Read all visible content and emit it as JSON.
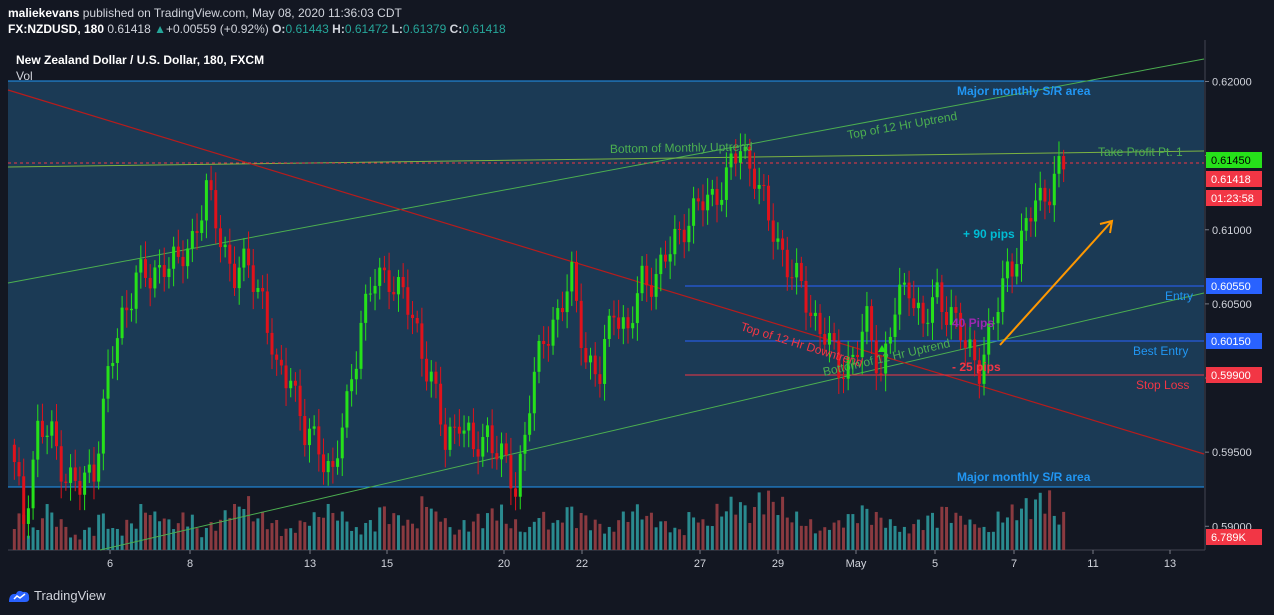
{
  "header": {
    "author": "maliekevans",
    "published_text": "published on TradingView.com, May 08, 2020 11:36:03 CDT",
    "symbol": "FX:NZDUSD, 180",
    "last": "0.61418",
    "change": "+0.00559 (+0.92%)",
    "o_label": "O:",
    "o": "0.61443",
    "h_label": "H:",
    "h": "0.61472",
    "l_label": "L:",
    "l": "0.61379",
    "c_label": "C:",
    "c": "0.61418"
  },
  "legend": {
    "title": "New Zealand Dollar / U.S. Dollar, 180, FXCM",
    "vol": "Vol"
  },
  "footer": {
    "brand": "TradingView"
  },
  "colors": {
    "plot_bg": "#1b3a55",
    "up": "#26e11a",
    "down": "#e0121b",
    "vol_up": "#2a8a8f",
    "vol_down": "#8a3a40",
    "accent_blue": "#2962ff"
  },
  "chart_data": {
    "type": "candlestick",
    "title": "New Zealand Dollar / U.S. Dollar, 180, FXCM",
    "ylim": [
      0.5884,
      0.6228
    ],
    "y_ticks": [
      "0.62000",
      "0.61500",
      "0.61000",
      "0.60500",
      "0.60000",
      "0.59500",
      "0.59000"
    ],
    "x_ticks": [
      "6",
      "8",
      "13",
      "15",
      "20",
      "22",
      "27",
      "29",
      "May",
      "5",
      "7",
      "11",
      "13"
    ],
    "price_labels": [
      {
        "text": "0.61450",
        "value": 0.6145,
        "color": "#26e11a",
        "text_color": "#000000"
      },
      {
        "text": "0.61418",
        "value": 0.61418,
        "color": "#f23645",
        "text_color": "#ffffff"
      },
      {
        "text": "01:23:58",
        "value": 0.6129,
        "color": "#f23645",
        "text_color": "#ffffff"
      },
      {
        "text": "0.60550",
        "value": 0.6055,
        "color": "#2962ff",
        "text_color": "#ffffff"
      },
      {
        "text": "0.60150",
        "value": 0.6015,
        "color": "#2962ff",
        "text_color": "#ffffff"
      },
      {
        "text": "0.59900",
        "value": 0.599,
        "color": "#f23645",
        "text_color": "#ffffff"
      },
      {
        "text": "6.789K",
        "value": 0.5902,
        "color": "#f23645",
        "text_color": "#ffffff"
      }
    ],
    "annotations": [
      {
        "text": "Major monthly S/R area",
        "color": "#2196f3"
      },
      {
        "text": "Major monthly S/R area",
        "color": "#2196f3"
      },
      {
        "text": "Top of 12 Hr Uptrend",
        "color": "#4caf50"
      },
      {
        "text": "Bottom of Monthly Uptrend",
        "color": "#4caf50"
      },
      {
        "text": "Take Profit Pt. 1",
        "color": "#4caf50"
      },
      {
        "text": "+ 90 pips",
        "color": "#00bcd4"
      },
      {
        "text": "Entry",
        "color": "#2196f3"
      },
      {
        "text": "40 Pips",
        "color": "#9c27b0"
      },
      {
        "text": "Best Entry",
        "color": "#2196f3"
      },
      {
        "text": "- 25 pips",
        "color": "#f23645"
      },
      {
        "text": "Stop Loss",
        "color": "#f23645"
      },
      {
        "text": "Top of 12 Hr Downtrend",
        "color": "#f23645"
      },
      {
        "text": "Bottom of 12 Hr Uptrend",
        "color": "#4caf50"
      }
    ],
    "levels": {
      "sr_top": 0.62,
      "sr_bottom": 0.5908,
      "take_profit": 0.6145,
      "entry": 0.6055,
      "best_entry": 0.6015,
      "stop_loss": 0.599,
      "current_price": 0.61418
    },
    "path": [
      0.5955,
      0.5905,
      0.5965,
      0.596,
      0.5935,
      0.5925,
      0.594,
      0.6,
      0.604,
      0.607,
      0.6065,
      0.608,
      0.6075,
      0.6095,
      0.6125,
      0.6095,
      0.607,
      0.6075,
      0.6055,
      0.6,
      0.6005,
      0.596,
      0.5955,
      0.5935,
      0.598,
      0.604,
      0.6065,
      0.607,
      0.6055,
      0.603,
      0.6,
      0.5955,
      0.5975,
      0.5948,
      0.5965,
      0.5945,
      0.5925,
      0.5985,
      0.6025,
      0.6045,
      0.6065,
      0.6015,
      0.6,
      0.605,
      0.603,
      0.6065,
      0.607,
      0.6085,
      0.6105,
      0.6115,
      0.6122,
      0.6135,
      0.6155,
      0.614,
      0.6105,
      0.6085,
      0.6065,
      0.6045,
      0.603,
      0.6005,
      0.6015,
      0.6035,
      0.6005,
      0.6045,
      0.6065,
      0.6035,
      0.6055,
      0.6045,
      0.602,
      0.601,
      0.6035,
      0.6075,
      0.609,
      0.612,
      0.6128,
      0.6142
    ],
    "volume": [
      5,
      3,
      6,
      4,
      2,
      3,
      5,
      3,
      4,
      6,
      5,
      4,
      5,
      3,
      4,
      6,
      7,
      5,
      4,
      3,
      4,
      5,
      6,
      5,
      3,
      4,
      6,
      5,
      4,
      7,
      5,
      3,
      4,
      5,
      6,
      4,
      3,
      5,
      4,
      6,
      5,
      4,
      3,
      5,
      6,
      5,
      4,
      3,
      5,
      4,
      6,
      7,
      6,
      8,
      7,
      5,
      4,
      3,
      4,
      5,
      6,
      5,
      4,
      3,
      4,
      5,
      6,
      5,
      4,
      3,
      5,
      6,
      7,
      8,
      5,
      3
    ]
  }
}
